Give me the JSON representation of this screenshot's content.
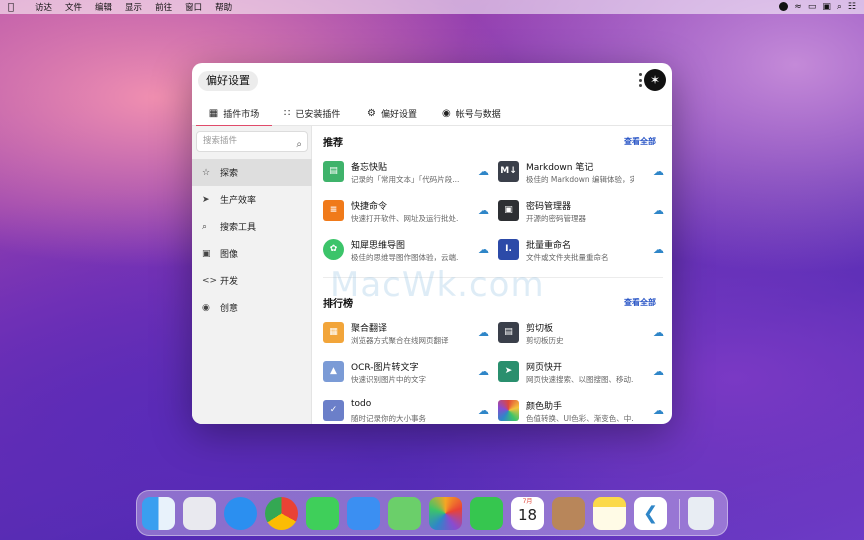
{
  "menubar": {
    "items": [
      "访达",
      "文件",
      "编辑",
      "显示",
      "前往",
      "窗口",
      "帮助"
    ]
  },
  "window": {
    "title": "偏好设置",
    "tabs": [
      {
        "label": "插件市场",
        "icon": "store-icon"
      },
      {
        "label": "已安装插件",
        "icon": "grid-icon"
      },
      {
        "label": "偏好设置",
        "icon": "gear-icon"
      },
      {
        "label": "帐号与数据",
        "icon": "user-icon"
      }
    ]
  },
  "sidebar": {
    "search_placeholder": "搜索插件",
    "items": [
      {
        "label": "探索",
        "icon": "star-icon"
      },
      {
        "label": "生产效率",
        "icon": "send-icon"
      },
      {
        "label": "搜索工具",
        "icon": "search-icon"
      },
      {
        "label": "图像",
        "icon": "image-icon"
      },
      {
        "label": "开发",
        "icon": "code-icon"
      },
      {
        "label": "创意",
        "icon": "palette-icon"
      }
    ]
  },
  "main": {
    "recommend": {
      "title": "推荐",
      "see_all": "查看全部",
      "cards": [
        {
          "name": "备忘快贴",
          "desc": "记录的「常用文本」「代码片段...",
          "icon": "clipboard-icon",
          "color": "#3fb36b"
        },
        {
          "name": "Markdown 笔记",
          "desc": "极佳的 Markdown 编辑体验，实...",
          "icon": "markdown-icon",
          "color": "#3a3f4a"
        },
        {
          "name": "快捷命令",
          "desc": "快速打开软件、网址及运行批处...",
          "icon": "command-icon",
          "color": "#f07a1a"
        },
        {
          "name": "密码管理器",
          "desc": "开源的密码管理器",
          "icon": "lock-icon",
          "color": "#2d2f33"
        },
        {
          "name": "知犀思维导图",
          "desc": "极佳的思维导图作图体验，云端...",
          "icon": "mindmap-icon",
          "color": "#3cc46a"
        },
        {
          "name": "批量重命名",
          "desc": "文件或文件夹批量重命名",
          "icon": "rename-icon",
          "color": "#2c4aa8"
        }
      ]
    },
    "ranking": {
      "title": "排行榜",
      "see_all": "查看全部",
      "cards": [
        {
          "name": "聚合翻译",
          "desc": "浏览器方式聚合在线网页翻译",
          "icon": "translate-icon",
          "color": "#f2a53a"
        },
        {
          "name": "剪切板",
          "desc": "剪切板历史",
          "icon": "clipboard-history-icon",
          "color": "#3a3f4a"
        },
        {
          "name": "OCR-图片转文字",
          "desc": "快速识别图片中的文字",
          "icon": "ocr-icon",
          "color": "#7b9bd6"
        },
        {
          "name": "网页快开",
          "desc": "网页快速搜索、以图搜图、移动...",
          "icon": "rocket-icon",
          "color": "#2a8f6e"
        },
        {
          "name": "todo",
          "desc": "随时记录你的大小事务",
          "icon": "check-icon",
          "color": "#6b7fc9"
        },
        {
          "name": "颜色助手",
          "desc": "色值转换、UI色彩、渐变色、中...",
          "icon": "color-icon",
          "color": "#e0463a"
        }
      ]
    }
  },
  "watermark": "MacWk.com",
  "dock": {
    "apps": [
      {
        "name": "finder-icon",
        "color": "#3a9ff0"
      },
      {
        "name": "launchpad-icon",
        "color": "#e9e9ef"
      },
      {
        "name": "safari-icon",
        "color": "#2b8ff0"
      },
      {
        "name": "chrome-icon",
        "color": "#f5f5f5"
      },
      {
        "name": "messages-icon",
        "color": "#3fcf5a"
      },
      {
        "name": "mail-icon",
        "color": "#3b8ff2"
      },
      {
        "name": "maps-icon",
        "color": "#6bcf6a"
      },
      {
        "name": "photos-icon",
        "color": "#f8f8f8"
      },
      {
        "name": "facetime-icon",
        "color": "#36c64f"
      },
      {
        "name": "calendar-icon",
        "color": "#ffffff"
      },
      {
        "name": "contacts-icon",
        "color": "#b8865a"
      },
      {
        "name": "notes-icon",
        "color": "#fbd94a"
      },
      {
        "name": "vscode-icon",
        "color": "#ffffff"
      },
      {
        "name": "trash-icon",
        "color": "#e8edf3"
      }
    ],
    "calendar_month": "7月",
    "calendar_day": "18"
  }
}
